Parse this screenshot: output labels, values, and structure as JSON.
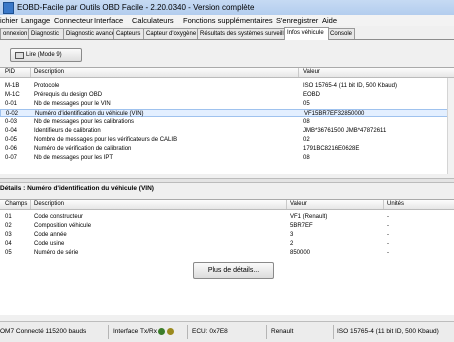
{
  "window": {
    "title": "EOBD-Facile par Outils OBD Facile - 2.20.0340 - Version complète"
  },
  "menu": [
    "ichier",
    "Langage",
    "Connecteur",
    "Interface",
    "Calculateurs",
    "Fonctions supplémentaires",
    "S'enregistrer",
    "Aide"
  ],
  "tabs": [
    "onnexion",
    "Diagnostic",
    "Diagnostic avancé",
    "Capteurs",
    "Capteur d'oxygène",
    "Résultats des systèmes surveillés",
    "Infos véhicule",
    "Console"
  ],
  "active_tab": "Infos véhicule",
  "toolbar": {
    "read_button": "Lire (Mode 9)"
  },
  "pid_table": {
    "headers": {
      "pid": "PID",
      "description": "Description",
      "value": "Valeur"
    },
    "rows": [
      {
        "pid": "M-1B",
        "description": "Protocole",
        "value": "ISO 15765-4 (11 bit ID, 500 Kbaud)"
      },
      {
        "pid": "M-1C",
        "description": "Prérequis du design OBD",
        "value": "EOBD"
      },
      {
        "pid": "0-01",
        "description": "Nb de messages pour le VIN",
        "value": "05"
      },
      {
        "pid": "0-02",
        "description": "Numéro d'identification du véhicule (VIN)",
        "value": "VF15BR7EF32850000"
      },
      {
        "pid": "0-03",
        "description": "Nb de messages pour les calibrations",
        "value": "08"
      },
      {
        "pid": "0-04",
        "description": "Identifieurs de calibration",
        "value": "JMB*36761500   JMB*47872611"
      },
      {
        "pid": "0-05",
        "description": "Nombre de messages pour les vérificateurs de CALIB",
        "value": "02"
      },
      {
        "pid": "0-06",
        "description": "Numéro de vérification de calibration",
        "value": "1791BC8216E0628E"
      },
      {
        "pid": "0-07",
        "description": "Nb de messages pour les IPT",
        "value": "08"
      }
    ],
    "selected_index": 3
  },
  "details": {
    "label": "Détails : Numéro d'identification du véhicule (VIN)",
    "headers": {
      "field": "Champs",
      "description": "Description",
      "value": "Valeur",
      "units": "Unités"
    },
    "rows": [
      {
        "field": "01",
        "description": "Code constructeur",
        "value": "VF1 (Renault)",
        "units": "-"
      },
      {
        "field": "02",
        "description": "Composition véhicule",
        "value": "5BR7EF",
        "units": "-"
      },
      {
        "field": "03",
        "description": "Code année",
        "value": "3",
        "units": "-"
      },
      {
        "field": "04",
        "description": "Code usine",
        "value": "2",
        "units": "-"
      },
      {
        "field": "05",
        "description": "Numéro de série",
        "value": "850000",
        "units": "-"
      }
    ],
    "more_button": "Plus de détails..."
  },
  "status": {
    "connection": "OM7 Connecté 115200 bauds",
    "interface": "Interface Tx/Rx",
    "ecu": "ECU: 0x7E8",
    "brand": "Renault",
    "protocol": "ISO 15765-4 (11 bit ID, 500 Kbaud)",
    "led_colors": [
      "#3c7d2a",
      "#9b8a1f"
    ]
  }
}
